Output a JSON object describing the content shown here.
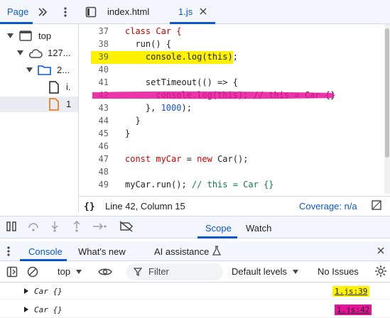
{
  "navigator": {
    "tab_page": "Page",
    "tree": [
      {
        "label": "top"
      },
      {
        "label": "127..."
      },
      {
        "label": "2..."
      },
      {
        "label": "i."
      },
      {
        "label": "1"
      }
    ]
  },
  "editor": {
    "tabs": [
      {
        "label": "index.html"
      },
      {
        "label": "1.js"
      }
    ],
    "lines": [
      {
        "n": "37"
      },
      {
        "n": "38"
      },
      {
        "n": "39"
      },
      {
        "n": "40"
      },
      {
        "n": "41"
      },
      {
        "n": "42"
      },
      {
        "n": "43"
      },
      {
        "n": "44"
      },
      {
        "n": "45"
      },
      {
        "n": "46"
      },
      {
        "n": "47"
      },
      {
        "n": "48"
      },
      {
        "n": "49"
      }
    ],
    "code": {
      "l37_kw": "class",
      "l37_rest": " Car {",
      "l38": "  run() {",
      "l39": "    console.log(this);",
      "l41_a": "    setTimeout(() => {",
      "l42": "      console.log(this); // this = Car {}",
      "l43_a": "    }, ",
      "l43_num": "1000",
      "l43_b": ");",
      "l44": "  }",
      "l45": "}",
      "l47_kw": "const",
      "l47_var": " myCar",
      "l47_eq": " = ",
      "l47_new": "new",
      "l47_rest": " Car();",
      "l49_code": "myCar.run(); ",
      "l49_cmt": "// this = Car {}"
    },
    "status": "Line 42, Column 15",
    "coverage": "Coverage: n/a",
    "highlight_color": "#fff200",
    "strike_color": "#e8129a"
  },
  "debugger": {
    "tab_scope": "Scope",
    "tab_watch": "Watch"
  },
  "drawer": {
    "tab_console": "Console",
    "tab_whats_new": "What's new",
    "tab_ai": "AI assistance"
  },
  "console_toolbar": {
    "context": "top",
    "filter_placeholder": "Filter",
    "levels": "Default levels",
    "issues": "No Issues"
  },
  "messages": [
    {
      "text": "Car {}",
      "source": "1.js:39"
    },
    {
      "text": "Car {}",
      "source": "1.js:42"
    }
  ]
}
